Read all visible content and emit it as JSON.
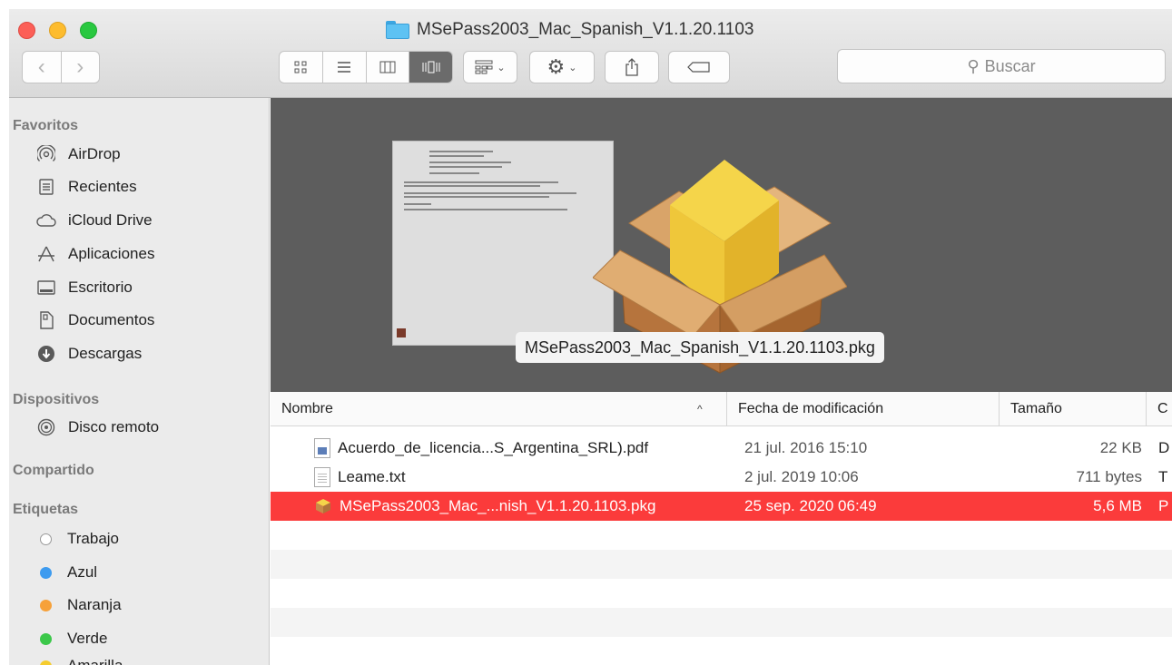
{
  "window": {
    "title": "MSePass2003_Mac_Spanish_V1.1.20.1103"
  },
  "toolbar": {
    "back_icon": "chevron-left-icon",
    "forward_icon": "chevron-right-icon",
    "views": [
      "icon-view",
      "list-view",
      "column-view",
      "cover-flow-view"
    ],
    "active_view": "cover-flow-view",
    "search_placeholder": "Buscar"
  },
  "sidebar": {
    "favorites_title": "Favoritos",
    "favorites": [
      {
        "label": "AirDrop",
        "icon": "airdrop-icon"
      },
      {
        "label": "Recientes",
        "icon": "recents-icon"
      },
      {
        "label": "iCloud Drive",
        "icon": "cloud-icon"
      },
      {
        "label": "Aplicaciones",
        "icon": "applications-icon"
      },
      {
        "label": "Escritorio",
        "icon": "desktop-icon"
      },
      {
        "label": "Documentos",
        "icon": "documents-icon"
      },
      {
        "label": "Descargas",
        "icon": "downloads-icon"
      }
    ],
    "devices_title": "Dispositivos",
    "devices": [
      {
        "label": "Disco remoto",
        "icon": "remote-disc-icon"
      }
    ],
    "shared_title": "Compartido",
    "tags_title": "Etiquetas",
    "tags": [
      {
        "label": "Trabajo",
        "color": "#ffffff"
      },
      {
        "label": "Azul",
        "color": "#3d9bef"
      },
      {
        "label": "Naranja",
        "color": "#f6a13a"
      },
      {
        "label": "Verde",
        "color": "#3cc84a"
      },
      {
        "label": "Amarilla",
        "color": "#f5cc2e"
      }
    ]
  },
  "preview": {
    "selected_label": "MSePass2003_Mac_Spanish_V1.1.20.1103.pkg"
  },
  "list": {
    "columns": {
      "name": "Nombre",
      "date": "Fecha de modificación",
      "size": "Tamaño",
      "kind": "C"
    },
    "rows": [
      {
        "name": "Acuerdo_de_licencia...S_Argentina_SRL).pdf",
        "date": "21 jul. 2016 15:10",
        "size": "22 KB",
        "kind": "D",
        "icon": "pdf-file-icon"
      },
      {
        "name": "Leame.txt",
        "date": "2 jul. 2019 10:06",
        "size": "711 bytes",
        "kind": "T",
        "icon": "text-file-icon"
      },
      {
        "name": "MSePass2003_Mac_...nish_V1.1.20.1103.pkg",
        "date": "25 sep. 2020 06:49",
        "size": "5,6 MB",
        "kind": "P",
        "icon": "package-icon"
      }
    ]
  },
  "colors": {
    "selection": "#fb3b3b",
    "preview_bg": "#5d5d5d",
    "sidebar_bg": "#ebebeb"
  }
}
